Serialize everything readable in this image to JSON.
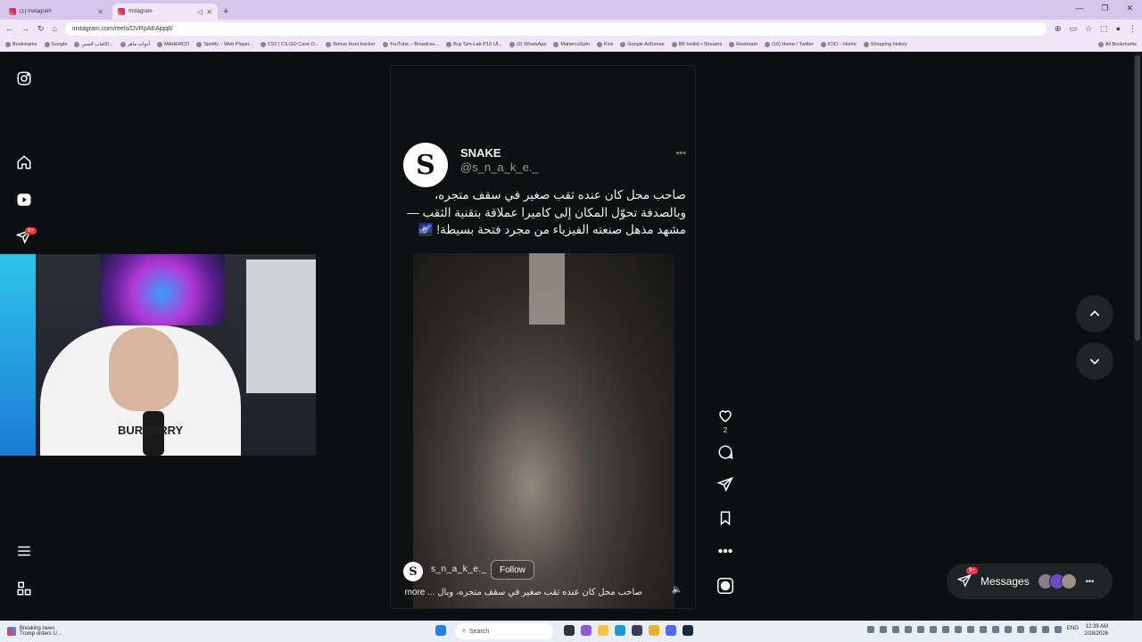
{
  "browser": {
    "tabs": [
      {
        "title": "(1) Instagram"
      },
      {
        "title": "Instagram"
      }
    ],
    "url": "instagram.com/reels/DVRpAEAjqq8/",
    "bookmarks": [
      "Bookmarks",
      "Google",
      "الالعاب المس...",
      "أدوات ماهر",
      "MAHERCO",
      "Spotify – Web Player...",
      "CS2 | CS:GO Case O...",
      "Bonus Hunt tracker",
      "YouTube – Broadcas...",
      "Buy Sim-Lab P1X Ul...",
      "(2) WhatsApp",
      "MahercoSpin",
      "Kick",
      "Google AdSense",
      "BB toolkit • Streams",
      "Restream",
      "(16) Home / Twitter",
      "ICIO – Home",
      "Shopping history",
      "All Bookmarks"
    ]
  },
  "sidebar": {
    "notifications_badge": "9+"
  },
  "webcam": {
    "shirt_text": "BURBERRY"
  },
  "post": {
    "author_name": "SNAKE",
    "author_handle": "@s_n_a_k_e._",
    "avatar_letter": "S",
    "text_lines": [
      "صاحب محل كان عنده ثقب صغير في سقف متجره،",
      "وبالصدفة تحوّل المكان إلى كاميرا عملاقة بتقنية الثقب —",
      "مشهد مذهل صنعته الفيزياء من مجرد فتحة بسيطة! 🌌"
    ],
    "footer_user": "s_n_a_k_e._",
    "follow_label": "Follow",
    "caption_preview": "صاحب محل كان عنده ثقب صغير في سقف متجره، وبال",
    "more_label": "... more",
    "likes_count": "2"
  },
  "messages": {
    "label": "Messages",
    "badge": "9+"
  },
  "taskbar": {
    "news_title": "Breaking news",
    "news_sub": "Trump orders U...",
    "search_placeholder": "Search",
    "lang": "ENG",
    "time": "12:39 AM",
    "date": "2/28/2026"
  }
}
